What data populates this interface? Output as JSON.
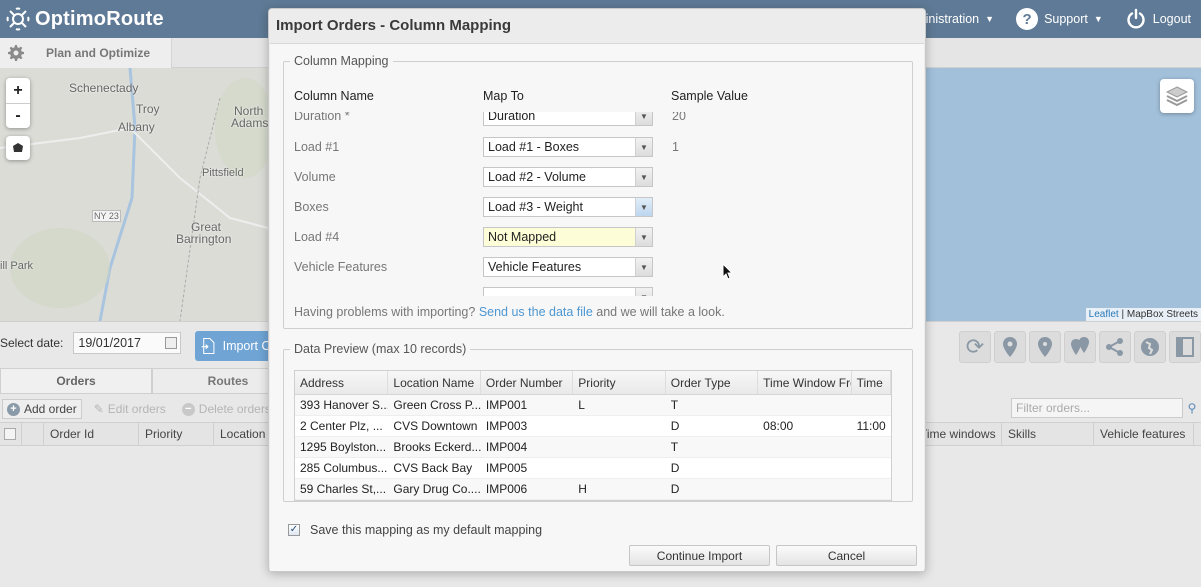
{
  "app": {
    "name": "OptimoRoute",
    "nav": {
      "administration": "Administration",
      "support": "Support",
      "logout": "Logout"
    },
    "subtab": "Plan and Optimize"
  },
  "map": {
    "labels": [
      "Schenectady",
      "Troy",
      "Albany",
      "North",
      "Adams",
      "Pittsfield",
      "NY 23",
      "Great",
      "Barrington",
      "ill Park"
    ],
    "zoom_in": "+",
    "zoom_out": "-",
    "attribution_link": "Leaflet",
    "attribution_rest": " | MapBox Streets"
  },
  "lower": {
    "date_label": "Select date:",
    "date_value": "19/01/2017",
    "import_label": "Import Orders",
    "tabs": [
      "Orders",
      "Routes"
    ],
    "toolbar": {
      "add": "Add order",
      "edit": "Edit orders",
      "delete": "Delete orders",
      "filter_placeholder": "Filter orders..."
    },
    "grid_columns": [
      "Order Id",
      "Priority",
      "Location",
      "Time windows",
      "Skills",
      "Vehicle features"
    ]
  },
  "modal": {
    "title": "Import Orders - Column Mapping",
    "mapping": {
      "legend": "Column Mapping",
      "headers": {
        "column_name": "Column Name",
        "map_to": "Map To",
        "sample_value": "Sample Value"
      },
      "rows": [
        {
          "name": "Duration *",
          "map_to": "Duration",
          "sample": "20"
        },
        {
          "name": "Load #1",
          "map_to": "Load #1 - Boxes",
          "sample": "1"
        },
        {
          "name": "Volume",
          "map_to": "Load #2 - Volume",
          "sample": ""
        },
        {
          "name": "Boxes",
          "map_to": "Load #3 - Weight",
          "sample": ""
        },
        {
          "name": "Load #4",
          "map_to": "Not Mapped",
          "sample": ""
        },
        {
          "name": "Vehicle Features",
          "map_to": "Vehicle Features",
          "sample": ""
        }
      ],
      "help_prefix": "Having problems with importing? ",
      "help_link": "Send us the data file",
      "help_suffix": " and we will take a look."
    },
    "preview": {
      "legend": "Data Preview (max 10 records)",
      "columns": [
        "Address",
        "Location Name",
        "Order Number",
        "Priority",
        "Order Type",
        "Time Window Fro",
        "Time"
      ],
      "rows": [
        [
          "393 Hanover S...",
          "Green Cross P...",
          "IMP001",
          "L",
          "T",
          "",
          ""
        ],
        [
          "2 Center Plz, ...",
          "CVS Downtown",
          "IMP003",
          "",
          "D",
          "08:00",
          "11:00"
        ],
        [
          "1295 Boylston...",
          "Brooks Eckerd...",
          "IMP004",
          "",
          "T",
          "",
          ""
        ],
        [
          "285 Columbus...",
          "CVS Back Bay",
          "IMP005",
          "",
          "D",
          "",
          ""
        ],
        [
          "59 Charles St,...",
          "Gary Drug Co....",
          "IMP006",
          "H",
          "D",
          "",
          ""
        ]
      ]
    },
    "save_default": {
      "label": "Save this mapping as my default mapping",
      "checked": true
    },
    "buttons": {
      "continue": "Continue Import",
      "cancel": "Cancel"
    }
  }
}
